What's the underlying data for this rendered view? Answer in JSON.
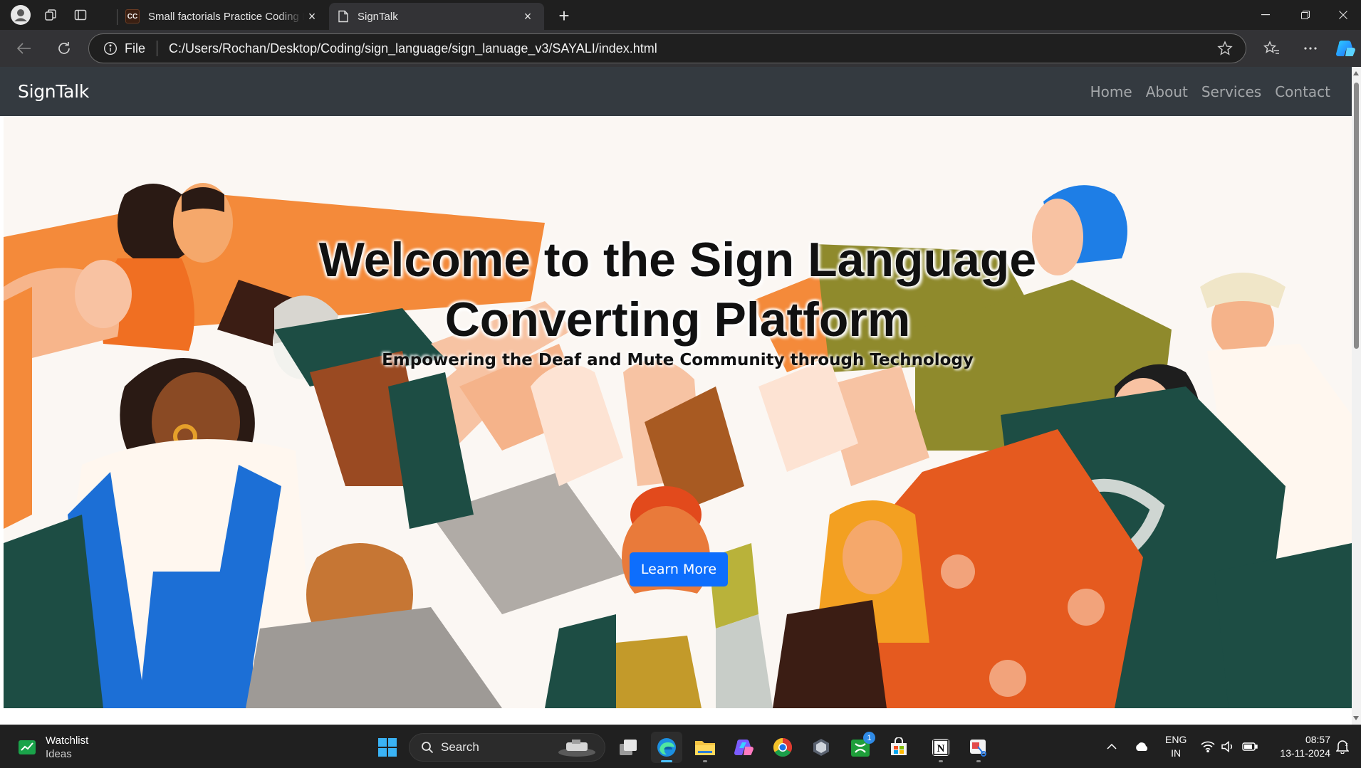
{
  "browser": {
    "tabs": [
      {
        "title": "Small factorials Practice Coding P",
        "favicon": "CC",
        "active": false
      },
      {
        "title": "SignTalk",
        "active": true
      }
    ],
    "address": {
      "scheme_label": "File",
      "url": "C:/Users/Rochan/Desktop/Coding/sign_language/sign_lanuage_v3/SAYALI/index.html"
    }
  },
  "site": {
    "brand": "SignTalk",
    "nav": [
      "Home",
      "About",
      "Services",
      "Contact"
    ],
    "hero": {
      "title_line1": "Welcome to the Sign Language",
      "title_line2": "Converting Platform",
      "subtitle": "Empowering the Deaf and Mute Community through Technology",
      "button": "Learn More"
    }
  },
  "taskbar": {
    "widget": {
      "title": "Watchlist",
      "subtitle": "Ideas"
    },
    "search_placeholder": "Search",
    "xbox_badge": "1",
    "language": {
      "line1": "ENG",
      "line2": "IN"
    },
    "clock": {
      "time": "08:57",
      "date": "13-11-2024"
    }
  },
  "colors": {
    "navbar": "#343a40",
    "primary_button": "#0d6efd",
    "browser_chrome": "#1f1f1f",
    "taskbar": "#202020"
  }
}
